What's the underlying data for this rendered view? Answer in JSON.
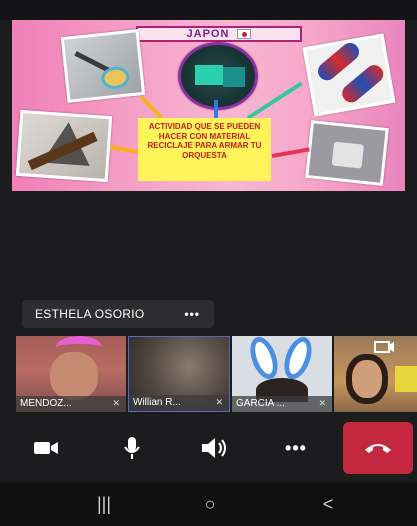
{
  "shared_content": {
    "title": "JAPON",
    "caption": "ACTIVIDAD QUE SE PUEDEN HACER CON MATERIAL RECICLAJE PARA ARMAR TU ORQUESTA"
  },
  "presenter": {
    "name": "ESTHELA OSORIO",
    "more_label": "•••"
  },
  "participants": [
    {
      "name": "MENDOZ...",
      "mic_icon": "mic-off-icon"
    },
    {
      "name": "Willian R...",
      "mic_icon": "mic-off-icon"
    },
    {
      "name": "GARCIA ...",
      "mic_icon": "mic-off-icon"
    },
    {
      "name": "",
      "mic_icon": ""
    }
  ],
  "controls": {
    "camera_icon": "video-camera-icon",
    "mic_icon": "microphone-icon",
    "speaker_icon": "speaker-icon",
    "more_label": "•••",
    "hangup_icon": "hang-up-icon",
    "hangup_color": "#c3283f"
  },
  "navbar": {
    "recents": "|||",
    "home": "○",
    "back": "<"
  }
}
